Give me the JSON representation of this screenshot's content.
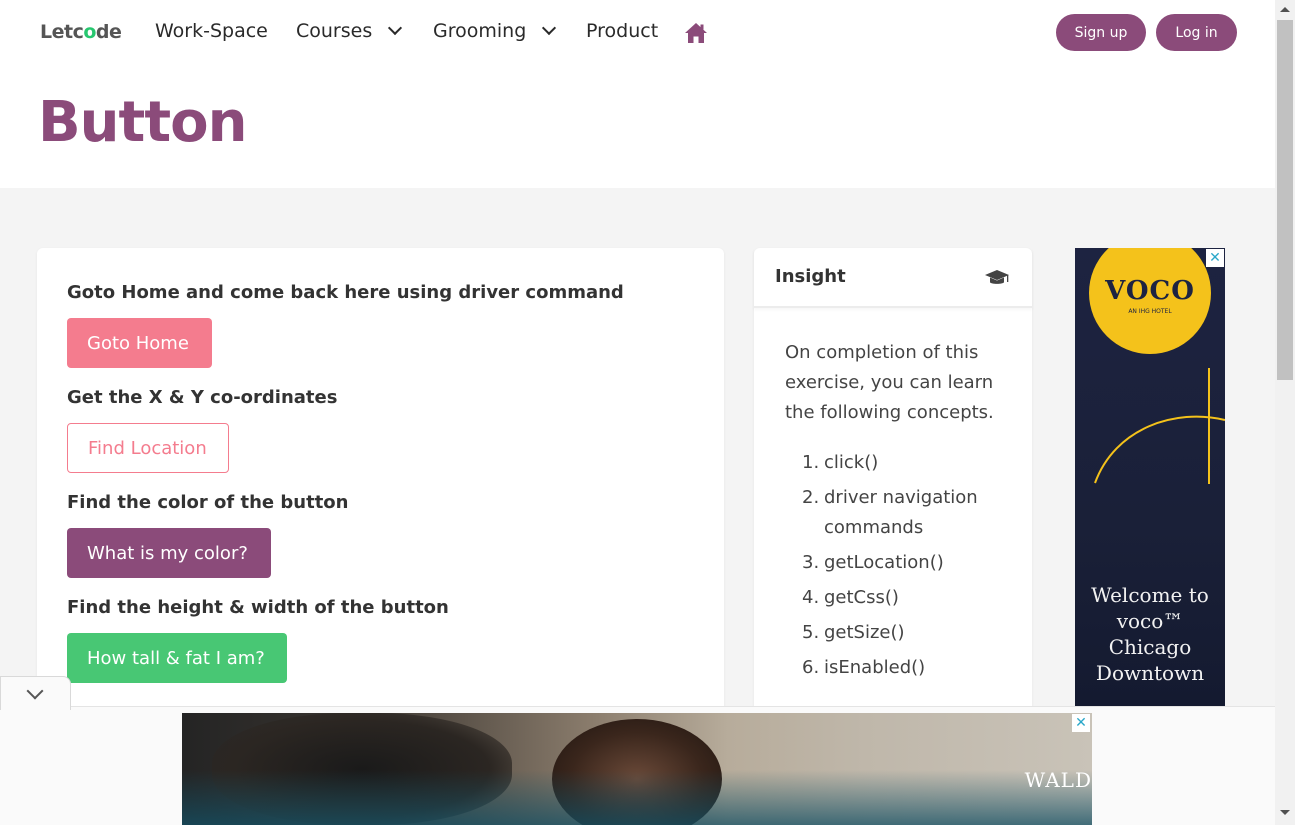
{
  "nav": {
    "logo_pre": "Let",
    "logo_o": "c",
    "logo_mid": "o",
    "logo_post": "de",
    "items": [
      {
        "label": "Work-Space"
      },
      {
        "label": "Courses"
      },
      {
        "label": "Grooming"
      },
      {
        "label": "Product"
      }
    ],
    "signup_label": "Sign up",
    "login_label": "Log in"
  },
  "page": {
    "title": "Button"
  },
  "main": {
    "questions": [
      {
        "label": "Goto Home and come back here using driver command",
        "button": "Goto Home"
      },
      {
        "label": "Get the X & Y co-ordinates",
        "button": "Find Location"
      },
      {
        "label": "Find the color of the button",
        "button": "What is my color?"
      },
      {
        "label": "Find the height & width of the button",
        "button": "How tall & fat I am?"
      }
    ]
  },
  "insight": {
    "title": "Insight",
    "intro": "On completion of this exercise, you can learn the following concepts.",
    "concepts": [
      {
        "num": "1.",
        "text": "click()"
      },
      {
        "num": "2.",
        "text": "driver navigation commands"
      },
      {
        "num": "3.",
        "text": "getLocation()"
      },
      {
        "num": "4.",
        "text": "getCss()"
      },
      {
        "num": "5.",
        "text": "getSize()"
      },
      {
        "num": "6.",
        "text": "isEnabled()"
      }
    ]
  },
  "side_ad": {
    "brand": "VOCO",
    "brand_sub": "AN IHG HOTEL",
    "welcome": "Welcome to voco™ Chicago Downtown",
    "close": "✕"
  },
  "bottom_ad": {
    "brand": "WALD",
    "close": "✕"
  },
  "colors": {
    "accent": "#8b4b7a",
    "pink": "#f47c8e",
    "green": "#48c774"
  }
}
